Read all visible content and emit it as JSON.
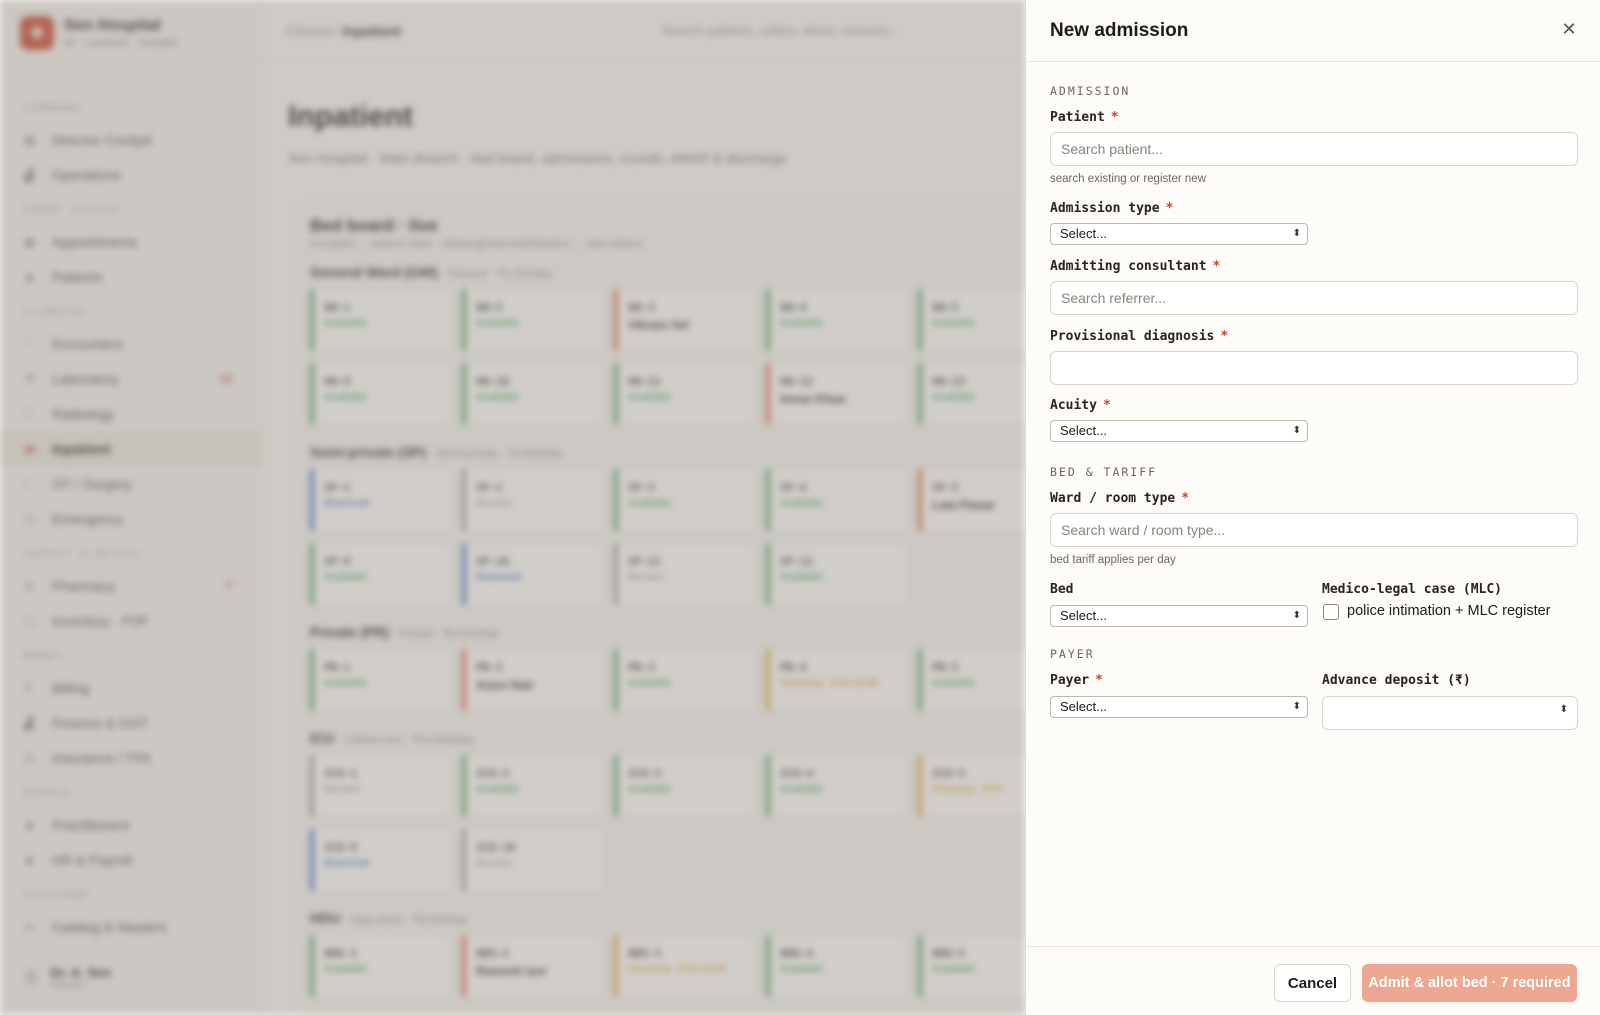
{
  "app": {
    "brand_name": "Sen Hospital",
    "brand_sub": "IN · Lucknow · Hospital",
    "breadcrumb_parent": "Clinical /",
    "breadcrumb_current": "Inpatient",
    "search_placeholder": "Search patients, orders, items, invoices...",
    "page_title": "Inpatient",
    "page_subtitle": "Sen Hospital · Main Branch · bed board, admissions, rounds, eMAR & discharge",
    "user_name": "Dr. A. Sen",
    "user_role": "Director"
  },
  "sidebar": {
    "sections": [
      {
        "title": "COMMAND",
        "items": [
          {
            "label": "Director Cockpit",
            "icon": "grid-icon"
          },
          {
            "label": "Operations",
            "icon": "chart-icon"
          }
        ]
      },
      {
        "title": "FRONT OFFICE",
        "items": [
          {
            "label": "Appointments",
            "icon": "calendar-icon"
          },
          {
            "label": "Patients",
            "icon": "people-icon"
          }
        ]
      },
      {
        "title": "CLINICAL",
        "items": [
          {
            "label": "Encounters",
            "icon": "heart-icon"
          },
          {
            "label": "Laboratory",
            "icon": "flask-icon",
            "badge": "12"
          },
          {
            "label": "Radiology",
            "icon": "scan-icon"
          },
          {
            "label": "Inpatient",
            "icon": "bed-icon",
            "active": true
          },
          {
            "label": "OT / Surgery",
            "icon": "scalpel-icon"
          },
          {
            "label": "Emergency",
            "icon": "alert-icon"
          }
        ]
      },
      {
        "title": "SUPPLY & RETAIL",
        "items": [
          {
            "label": "Pharmacy",
            "icon": "pill-icon",
            "badge": "7"
          },
          {
            "label": "Inventory · P2P",
            "icon": "box-icon"
          }
        ]
      },
      {
        "title": "MONEY",
        "items": [
          {
            "label": "Billing",
            "icon": "rupee-icon"
          },
          {
            "label": "Finance & GST",
            "icon": "chart-icon"
          },
          {
            "label": "Insurance / TPA",
            "icon": "shield-icon"
          }
        ]
      },
      {
        "title": "PEOPLE",
        "items": [
          {
            "label": "Practitioners",
            "icon": "people-icon"
          },
          {
            "label": "HR & Payroll",
            "icon": "people-icon"
          }
        ]
      },
      {
        "title": "PLATFORM",
        "items": [
          {
            "label": "Catalog & Masters",
            "icon": "list-icon"
          }
        ]
      }
    ]
  },
  "board": {
    "title": "Bed board · live",
    "subtitle": "occupied → patient chart · cleaning/reserved/blocked → bed actions",
    "wards": [
      {
        "name": "General Ward (GW)",
        "meta": "General · ₹1,200/day",
        "beds": [
          {
            "id": "GW-1",
            "status": "Available",
            "kind": "ok"
          },
          {
            "id": "GW-2",
            "status": "Available",
            "kind": "ok"
          },
          {
            "id": "GW-3",
            "status": "Vikram Sel",
            "kind": "occ"
          },
          {
            "id": "GW-4",
            "status": "Available",
            "kind": "ok"
          },
          {
            "id": "GW-5",
            "status": "Available",
            "kind": "ok"
          },
          {
            "id": "GW-9",
            "status": "Available",
            "kind": "ok"
          },
          {
            "id": "GW-10",
            "status": "Available",
            "kind": "ok"
          },
          {
            "id": "GW-11",
            "status": "Available",
            "kind": "ok"
          },
          {
            "id": "GW-12",
            "status": "Imran Khan",
            "kind": "occ"
          },
          {
            "id": "GW-13",
            "status": "Available",
            "kind": "ok"
          }
        ]
      },
      {
        "name": "Semi-private (SP)",
        "meta": "Semi-private · ₹3,500/day",
        "beds": [
          {
            "id": "SP-1",
            "status": "Reserved",
            "kind": "res"
          },
          {
            "id": "SP-2",
            "status": "Blocked",
            "kind": "blk"
          },
          {
            "id": "SP-3",
            "status": "Available",
            "kind": "ok"
          },
          {
            "id": "SP-4",
            "status": "Available",
            "kind": "ok"
          },
          {
            "id": "SP-5",
            "status": "Lata Pawar",
            "kind": "occ"
          },
          {
            "id": "SP-9",
            "status": "Available",
            "kind": "ok"
          },
          {
            "id": "SP-10",
            "status": "Reserved",
            "kind": "res"
          },
          {
            "id": "SP-11",
            "status": "Blocked",
            "kind": "blk"
          },
          {
            "id": "SP-12",
            "status": "Available",
            "kind": "ok"
          }
        ]
      },
      {
        "name": "Private (PR)",
        "meta": "Private · ₹6,000/day",
        "beds": [
          {
            "id": "PR-1",
            "status": "Available",
            "kind": "ok"
          },
          {
            "id": "PR-2",
            "status": "Arjun Nair",
            "kind": "occ"
          },
          {
            "id": "PR-3",
            "status": "Available",
            "kind": "ok"
          },
          {
            "id": "PR-4",
            "status": "Cleaning · ETA 19:40",
            "kind": "cln"
          },
          {
            "id": "PR-5",
            "status": "Available",
            "kind": "ok"
          }
        ]
      },
      {
        "name": "ICU",
        "meta": "Critical care · ₹12,000/day",
        "beds": [
          {
            "id": "ICU-1",
            "status": "Blocked",
            "kind": "blk"
          },
          {
            "id": "ICU-2",
            "status": "Available",
            "kind": "ok"
          },
          {
            "id": "ICU-3",
            "status": "Available",
            "kind": "ok"
          },
          {
            "id": "ICU-4",
            "status": "Available",
            "kind": "ok"
          },
          {
            "id": "ICU-5",
            "status": "Cleaning · ETA",
            "kind": "cln"
          },
          {
            "id": "ICU-9",
            "status": "Reserved",
            "kind": "res"
          },
          {
            "id": "ICU-10",
            "status": "Blocked",
            "kind": "blk"
          }
        ]
      },
      {
        "name": "HDU",
        "meta": "Step-down · ₹8,000/day",
        "beds": [
          {
            "id": "HDU-1",
            "status": "Available",
            "kind": "ok"
          },
          {
            "id": "HDU-2",
            "status": "Ramesh Iyer",
            "kind": "occ"
          },
          {
            "id": "HDU-3",
            "status": "Cleaning · ETA 19:35",
            "kind": "cln"
          },
          {
            "id": "HDU-4",
            "status": "Available",
            "kind": "ok"
          },
          {
            "id": "HDU-5",
            "status": "Available",
            "kind": "ok"
          }
        ]
      }
    ]
  },
  "drawer": {
    "title": "New admission",
    "close_icon": "close-icon",
    "sections": {
      "admission": "ADMISSION",
      "bed_tariff": "BED & TARIFF",
      "payer": "PAYER"
    },
    "fields": {
      "patient": {
        "label": "Patient",
        "placeholder": "Search patient...",
        "hint": "search existing or register new",
        "value": ""
      },
      "admission_type": {
        "label": "Admission type",
        "value": "Select..."
      },
      "admitting_consultant": {
        "label": "Admitting consultant",
        "placeholder": "Search referrer...",
        "value": ""
      },
      "provisional_diagnosis": {
        "label": "Provisional diagnosis",
        "value": ""
      },
      "acuity": {
        "label": "Acuity",
        "value": "Select..."
      },
      "ward_room_type": {
        "label": "Ward / room type",
        "placeholder": "Search ward / room type...",
        "hint": "bed tariff applies per day",
        "value": ""
      },
      "bed": {
        "label": "Bed",
        "value": "Select..."
      },
      "mlc": {
        "label": "Medico-legal case (MLC)",
        "checkbox_label": "police intimation + MLC register",
        "checked": false
      },
      "payer": {
        "label": "Payer",
        "value": "Select..."
      },
      "advance_deposit": {
        "label": "Advance deposit (₹)",
        "value": ""
      }
    },
    "required_mark": "*",
    "cancel_label": "Cancel",
    "submit_label": "Admit & allot bed · 7 required"
  },
  "colors": {
    "accent": "#c8462a",
    "submit_disabled": "#eda68f",
    "available": "#4aa35a",
    "reserved": "#4a6fc6",
    "cleaning": "#d9a23a",
    "occupied": "#d96a3a"
  }
}
